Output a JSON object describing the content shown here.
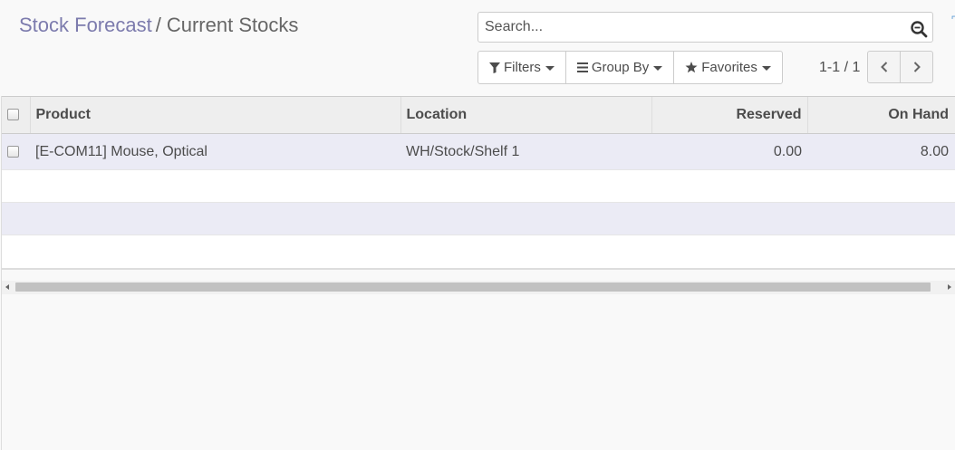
{
  "breadcrumb": {
    "parent": "Stock Forecast",
    "separator": "/",
    "current": "Current Stocks"
  },
  "search": {
    "placeholder": "Search...",
    "value": ""
  },
  "filters": {
    "filters_label": "Filters",
    "group_by_label": "Group By",
    "favorites_label": "Favorites"
  },
  "pager": {
    "value": "1-1 / 1"
  },
  "table": {
    "columns": {
      "product": "Product",
      "location": "Location",
      "reserved": "Reserved",
      "on_hand": "On Hand"
    },
    "rows": [
      {
        "product": "[E-COM11] Mouse, Optical",
        "location": "WH/Stock/Shelf 1",
        "reserved": "0.00",
        "on_hand": "8.00"
      }
    ]
  },
  "icons": {
    "search": "search-icon",
    "filter": "filter-icon",
    "group_by": "bars-icon",
    "favorites": "star-icon",
    "pager_prev": "chevron-left-icon",
    "pager_next": "chevron-right-icon"
  },
  "colors": {
    "breadcrumb_link": "#7c7bad",
    "row_highlight": "#ebebf5",
    "header_bg": "#eeeeee"
  }
}
